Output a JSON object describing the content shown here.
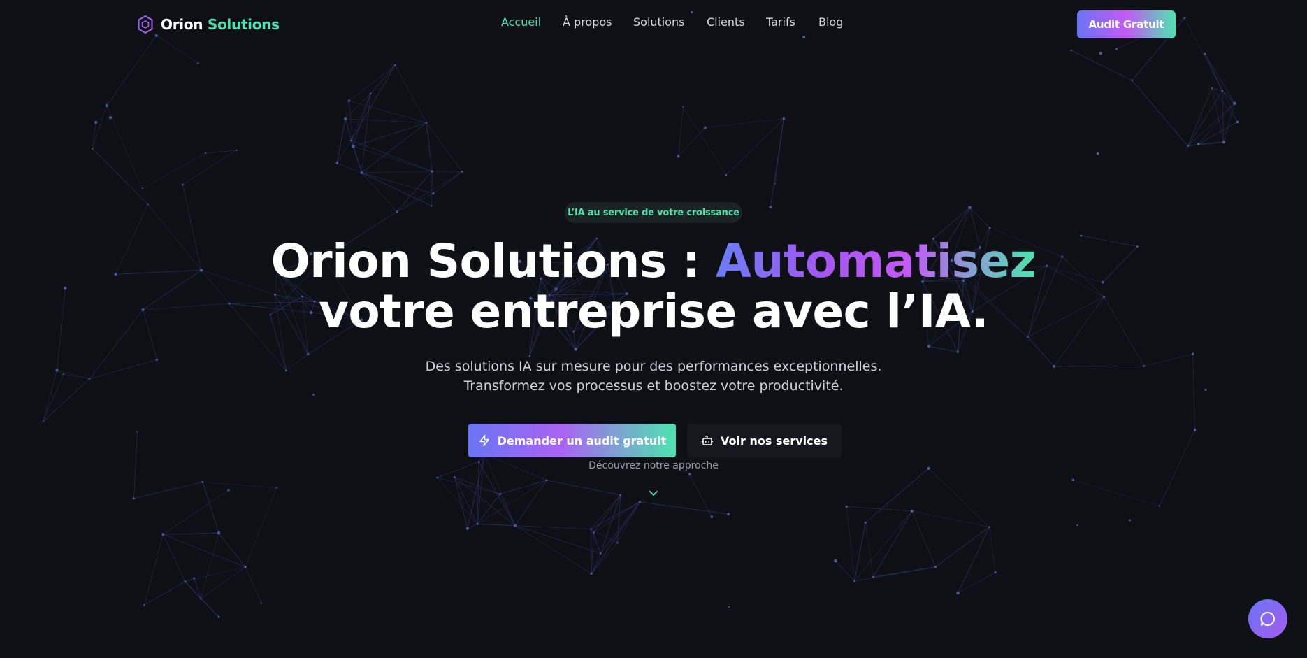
{
  "brand": {
    "name_part1": "Orion",
    "name_part2": "Solutions",
    "logo_icon": "hexagon-logo-icon"
  },
  "nav": {
    "items": [
      {
        "label": "Accueil",
        "active": true
      },
      {
        "label": "À propos",
        "active": false
      },
      {
        "label": "Solutions",
        "active": false
      },
      {
        "label": "Clients",
        "active": false
      },
      {
        "label": "Tarifs",
        "active": false
      },
      {
        "label": "Blog",
        "active": false
      }
    ],
    "cta_label": "Audit Gratuit"
  },
  "hero": {
    "badge": "L’IA au service de votre croissance",
    "title_part1": "Orion Solutions : ",
    "title_highlight": "Automatisez",
    "title_part2": "votre entreprise avec l’IA.",
    "subtitle_line1": "Des solutions IA sur mesure pour des performances exceptionnelles.",
    "subtitle_line2": "Transformez vos processus et boostez votre productivité.",
    "primary_button": {
      "label": "Demander un audit gratuit",
      "icon": "lightning-icon"
    },
    "secondary_button": {
      "label": "Voir nos services",
      "icon": "robot-icon"
    },
    "scroll_hint": "Découvrez notre approche",
    "scroll_icon": "chevron-down-icon"
  },
  "chat": {
    "icon": "chat-bubble-icon"
  },
  "colors": {
    "background": "#0f1016",
    "accent_green": "#4ee3b0",
    "accent_purple": "#6a75f3",
    "accent_pink": "#c25af3",
    "network_line": "#2f3a78",
    "network_node": "#5966b8"
  }
}
